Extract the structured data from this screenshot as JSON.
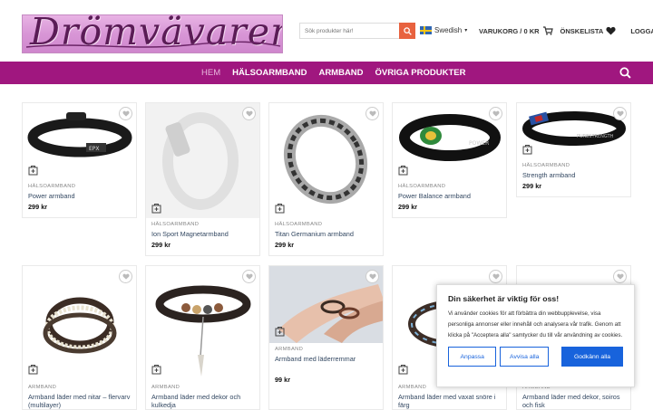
{
  "header": {
    "logo_text": "Drömvävaren",
    "search_placeholder": "Sök produkter här!",
    "language": "Swedish",
    "cart_label": "VARUKORG / 0 KR",
    "wishlist_label": "ÖNSKELISTA",
    "login_label": "LOGGA IN"
  },
  "nav": {
    "items": [
      "HEM",
      "HÄLSOARMBAND",
      "ARMBAND",
      "ÖVRIGA PRODUKTER"
    ]
  },
  "products": [
    {
      "category": "HÄLSOARMBAND",
      "name": "Power armband",
      "price": "299 kr"
    },
    {
      "category": "HÄLSOARMBAND",
      "name": "Ion Sport Magnetarmband",
      "price": "299 kr"
    },
    {
      "category": "HÄLSOARMBAND",
      "name": "Titan Germanium armband",
      "price": "299 kr"
    },
    {
      "category": "HÄLSOARMBAND",
      "name": "Power Balance armband",
      "price": "299 kr"
    },
    {
      "category": "HÄLSOARMBAND",
      "name": "Strength armband",
      "price": "299 kr"
    },
    {
      "category": "ARMBAND",
      "name": "Armband läder med nitar – flervarv (multilayer)",
      "price": ""
    },
    {
      "category": "ARMBAND",
      "name": "Armband läder med dekor och kulkedja",
      "price": ""
    },
    {
      "category": "ARMBAND",
      "name": "Armband med läderremmar",
      "price": "99 kr"
    },
    {
      "category": "ARMBAND",
      "name": "Armband läder med vaxat snöre i färg",
      "price": ""
    },
    {
      "category": "ARMBAND",
      "name": "Armband läder med dekor, soiros och fisk",
      "price": ""
    }
  ],
  "cookie": {
    "title": "Din säkerhet är viktig för oss!",
    "text": "Vi använder cookies för att förbättra din webbupplevelse, visa personliga annonser eller innehåll och analysera vår trafik. Genom att klicka på \"Acceptera alla\" samtycker du till vår användning av cookies.",
    "customize": "Anpassa",
    "reject": "Avvisa alla",
    "accept": "Godkänn alla"
  },
  "colors": {
    "brand": "#a0177f",
    "search_button": "#e8623f",
    "cookie_accent": "#1863dc"
  }
}
